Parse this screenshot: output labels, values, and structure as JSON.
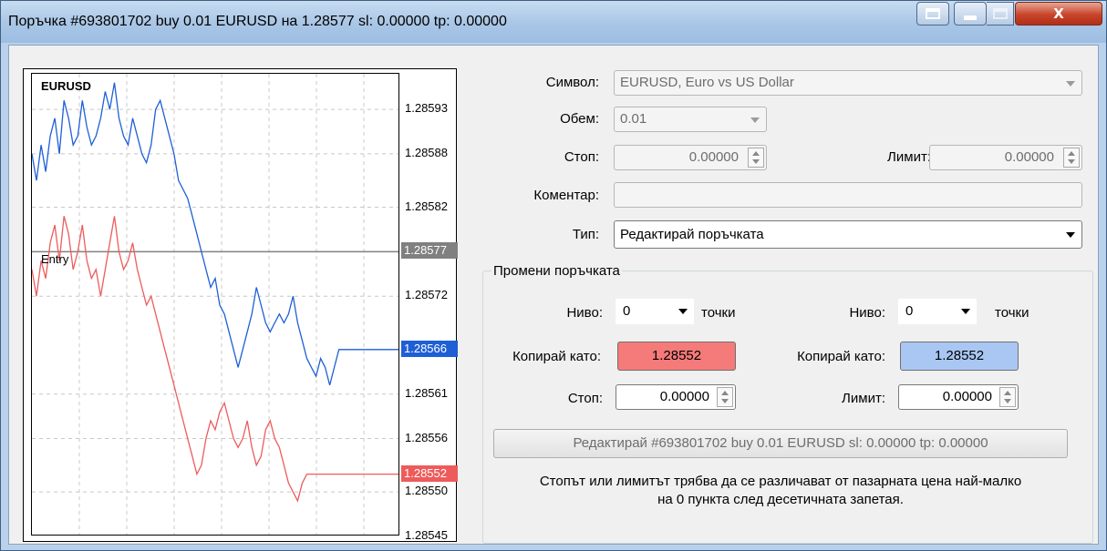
{
  "window": {
    "title": "Поръчка #693801702 buy 0.01 EURUSD на 1.28577 sl: 0.00000 tp: 0.00000"
  },
  "chart": {
    "symbol": "EURUSD",
    "entry_label": "Entry",
    "price_ticks": [
      "1.28593",
      "1.28588",
      "1.28582",
      "1.28572",
      "1.28561",
      "1.28556",
      "1.28550",
      "1.28545"
    ],
    "entry_price": "1.28577",
    "bid_price": "1.28566",
    "ask_price": "1.28552"
  },
  "chart_data": {
    "type": "line",
    "title": "EURUSD",
    "ylim": [
      1.28545,
      1.28597
    ],
    "series": [
      {
        "color": "#1f5fd6",
        "values": [
          1.28588,
          1.28585,
          1.28589,
          1.28586,
          1.2859,
          1.28592,
          1.28588,
          1.28594,
          1.28592,
          1.28589,
          1.2859,
          1.28594,
          1.28591,
          1.28589,
          1.2859,
          1.28592,
          1.28595,
          1.28593,
          1.28596,
          1.28592,
          1.2859,
          1.28589,
          1.28592,
          1.2859,
          1.28588,
          1.28587,
          1.28589,
          1.28593,
          1.28594,
          1.28592,
          1.2859,
          1.28588,
          1.28585,
          1.28584,
          1.28583,
          1.28581,
          1.28579,
          1.28577,
          1.28575,
          1.28573,
          1.28574,
          1.28571,
          1.2857,
          1.28568,
          1.28566,
          1.28564,
          1.28566,
          1.28568,
          1.2857,
          1.28573,
          1.28571,
          1.28569,
          1.28568,
          1.28569,
          1.2857,
          1.28569,
          1.2857,
          1.28572,
          1.28569,
          1.28567,
          1.28565,
          1.28564,
          1.28563,
          1.28565,
          1.28564,
          1.28562,
          1.28564,
          1.28566,
          1.28566,
          1.28566,
          1.28566,
          1.28566,
          1.28566,
          1.28566,
          1.28566,
          1.28566,
          1.28566,
          1.28566,
          1.28566,
          1.28566,
          1.28566
        ]
      },
      {
        "color": "#ee5b5b",
        "values": [
          1.28575,
          1.28572,
          1.28576,
          1.28574,
          1.28578,
          1.2858,
          1.28576,
          1.28581,
          1.28579,
          1.28575,
          1.28577,
          1.2858,
          1.28576,
          1.28574,
          1.28575,
          1.28572,
          1.28575,
          1.28578,
          1.28581,
          1.28577,
          1.28575,
          1.28576,
          1.28578,
          1.28575,
          1.28573,
          1.28571,
          1.28572,
          1.2857,
          1.28568,
          1.28566,
          1.28564,
          1.28562,
          1.2856,
          1.28558,
          1.28556,
          1.28554,
          1.28552,
          1.28553,
          1.28556,
          1.28558,
          1.28557,
          1.28559,
          1.2856,
          1.28558,
          1.28556,
          1.28555,
          1.28556,
          1.28558,
          1.28555,
          1.28553,
          1.28554,
          1.28557,
          1.28558,
          1.28556,
          1.28555,
          1.28553,
          1.28551,
          1.2855,
          1.28549,
          1.28551,
          1.28552,
          1.28552,
          1.28552,
          1.28552,
          1.28552,
          1.28552,
          1.28552,
          1.28552,
          1.28552,
          1.28552,
          1.28552,
          1.28552,
          1.28552,
          1.28552,
          1.28552,
          1.28552,
          1.28552,
          1.28552,
          1.28552,
          1.28552,
          1.28552
        ]
      }
    ],
    "reference_line": 1.28577
  },
  "form": {
    "symbol_label": "Символ:",
    "symbol_value": "EURUSD, Euro vs US Dollar",
    "volume_label": "Обем:",
    "volume_value": "0.01",
    "stop_label": "Стоп:",
    "stop_value": "0.00000",
    "limit_label": "Лимит:",
    "limit_value": "0.00000",
    "comment_label": "Коментар:",
    "comment_value": "",
    "type_label": "Тип:",
    "type_value": "Редактирай поръчката"
  },
  "modify": {
    "group_title": "Промени поръчката",
    "level_label_left": "Ниво:",
    "level_value_left": "0",
    "points_left": "точки",
    "level_label_right": "Ниво:",
    "level_value_right": "0",
    "points_right": "точки",
    "copy_label_left": "Копирай като:",
    "copy_value_left": "1.28552",
    "copy_label_right": "Копирай като:",
    "copy_value_right": "1.28552",
    "stop_label": "Стоп:",
    "stop_value": "0.00000",
    "limit_label": "Лимит:",
    "limit_value": "0.00000",
    "modify_button": "Редактирай #693801702 buy 0.01 EURUSD sl: 0.00000 tp: 0.00000",
    "note_line1": "Стопът или лимитът трябва да се различават от пазарната цена най-малко",
    "note_line2": "на 0 пункта след десетичната запетая.",
    "copy_left_color": "#f57a7a",
    "copy_right_color": "#a9c7f2"
  }
}
